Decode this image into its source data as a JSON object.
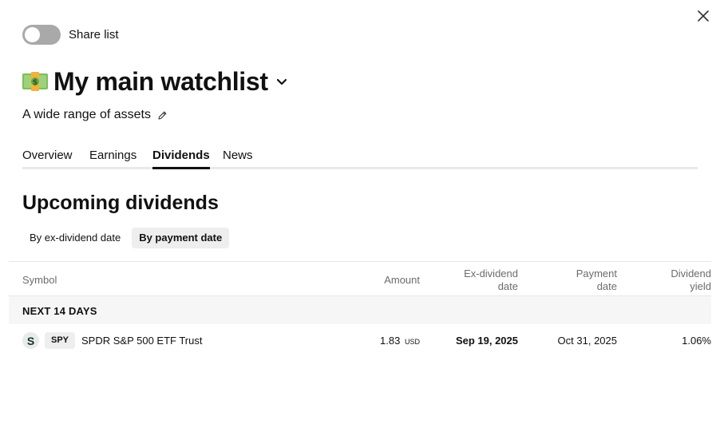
{
  "share": {
    "label": "Share list",
    "enabled": false
  },
  "watchlist": {
    "emoji": "dollar-banknote-icon",
    "title": "My main watchlist",
    "description": "A wide range of assets"
  },
  "tabs": [
    {
      "label": "Overview",
      "active": false
    },
    {
      "label": "Earnings",
      "active": false
    },
    {
      "label": "Dividends",
      "active": true
    },
    {
      "label": "News",
      "active": false
    }
  ],
  "section": {
    "title": "Upcoming dividends",
    "filters": [
      {
        "label": "By ex-dividend date",
        "active": false
      },
      {
        "label": "By payment date",
        "active": true
      }
    ]
  },
  "table": {
    "columns": {
      "symbol": "Symbol",
      "amount": "Amount",
      "exdiv_line1": "Ex-dividend",
      "exdiv_line2": "date",
      "paydate_line1": "Payment",
      "paydate_line2": "date",
      "yield_line1": "Dividend",
      "yield_line2": "yield"
    },
    "group_label": "NEXT 14 DAYS",
    "rows": [
      {
        "logo_letter": "S",
        "ticker": "SPY",
        "name": "SPDR S&P 500 ETF Trust",
        "amount": "1.83",
        "currency": "USD",
        "ex_dividend_date": "Sep 19, 2025",
        "payment_date": "Oct 31, 2025",
        "dividend_yield": "1.06%"
      }
    ]
  },
  "colors": {
    "toggle_off": "#a9a9a9",
    "tab_underline": "#111111",
    "active_pill_bg": "#eeeeee",
    "group_bg": "#f6f6f6"
  }
}
